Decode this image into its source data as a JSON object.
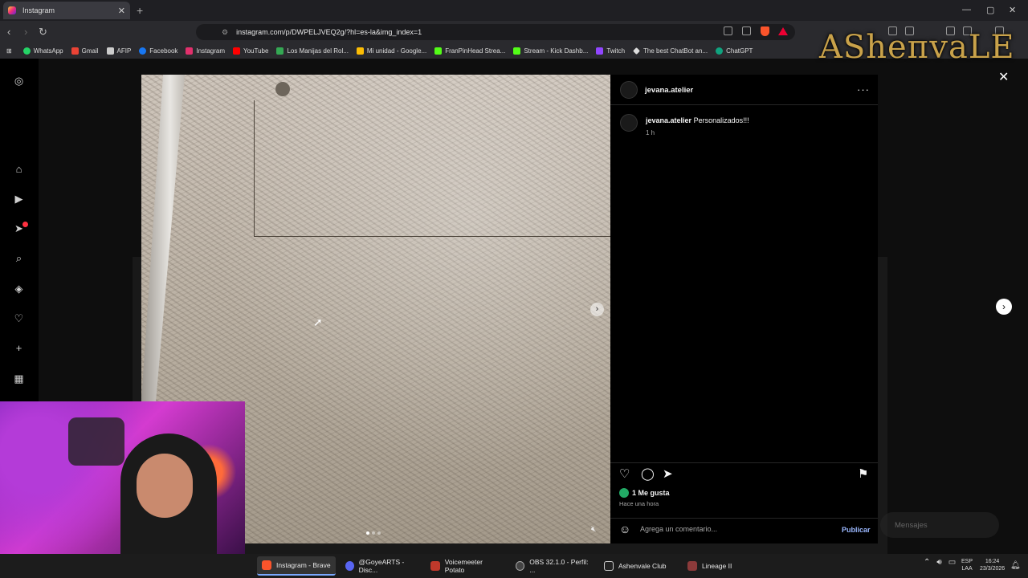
{
  "browser": {
    "tab_title": "Instagram",
    "new_tab": "+",
    "url": "instagram.com/p/DWPELJVEQ2g/?hl=es-la&img_index=1",
    "window_controls": [
      "—",
      "▢",
      "✕"
    ]
  },
  "bookmarks": [
    {
      "label": "WhatsApp",
      "color": "#25d366"
    },
    {
      "label": "Gmail",
      "color": "#ea4335"
    },
    {
      "label": "AFIP",
      "color": "#cccccc"
    },
    {
      "label": "Facebook",
      "color": "#1877f2"
    },
    {
      "label": "Instagram",
      "color": "#e1306c"
    },
    {
      "label": "YouTube",
      "color": "#ff0000"
    },
    {
      "label": "Los Manijas del Rol...",
      "color": "#34a853"
    },
    {
      "label": "Mi unidad - Google...",
      "color": "#fbbc04"
    },
    {
      "label": "FranPinHead Strea...",
      "color": "#53fc18"
    },
    {
      "label": "Stream - Kick Dashb...",
      "color": "#53fc18"
    },
    {
      "label": "Twitch",
      "color": "#9146ff"
    },
    {
      "label": "The best ChatBot an...",
      "color": "#dddddd"
    },
    {
      "label": "ChatGPT",
      "color": "#10a37f"
    }
  ],
  "post": {
    "username": "jevana.atelier",
    "caption_user": "jevana.atelier",
    "caption_text": "Personalizados!!!",
    "caption_time": "1 h",
    "likes": "1 Me gusta",
    "posted_ago": "Hace una hora",
    "comment_placeholder": "Agrega un comentario...",
    "publish_label": "Publicar",
    "more": "···"
  },
  "overlay": {
    "messages_label": "Mensajes",
    "brand_logo_text": "ASheпvaLE"
  },
  "taskbar": {
    "items": [
      {
        "label": "Instagram - Brave",
        "color": "#fb542b"
      },
      {
        "label": "@GoyeARTS - Disc...",
        "color": "#5865f2"
      },
      {
        "label": "Voicemeeter Potato",
        "color": "#c0392b"
      },
      {
        "label": "OBS 32.1.0 - Perfil: ...",
        "color": "#444444"
      },
      {
        "label": "Ashenvale Club",
        "color": "#222222"
      },
      {
        "label": "Lineage II",
        "color": "#8b3a3a"
      }
    ],
    "lang_top": "ESP",
    "lang_bottom": "LAA",
    "time": "16:24",
    "date": "23/3/2026"
  },
  "icons": [
    "instagram-icon",
    "home-icon",
    "reels-icon",
    "send-icon",
    "search-icon",
    "explore-icon",
    "heart-icon",
    "plus-icon",
    "dashboard-icon",
    "comment-icon",
    "bookmark-icon",
    "emoji-icon",
    "close-icon",
    "chevron-right-icon",
    "mute-icon"
  ]
}
